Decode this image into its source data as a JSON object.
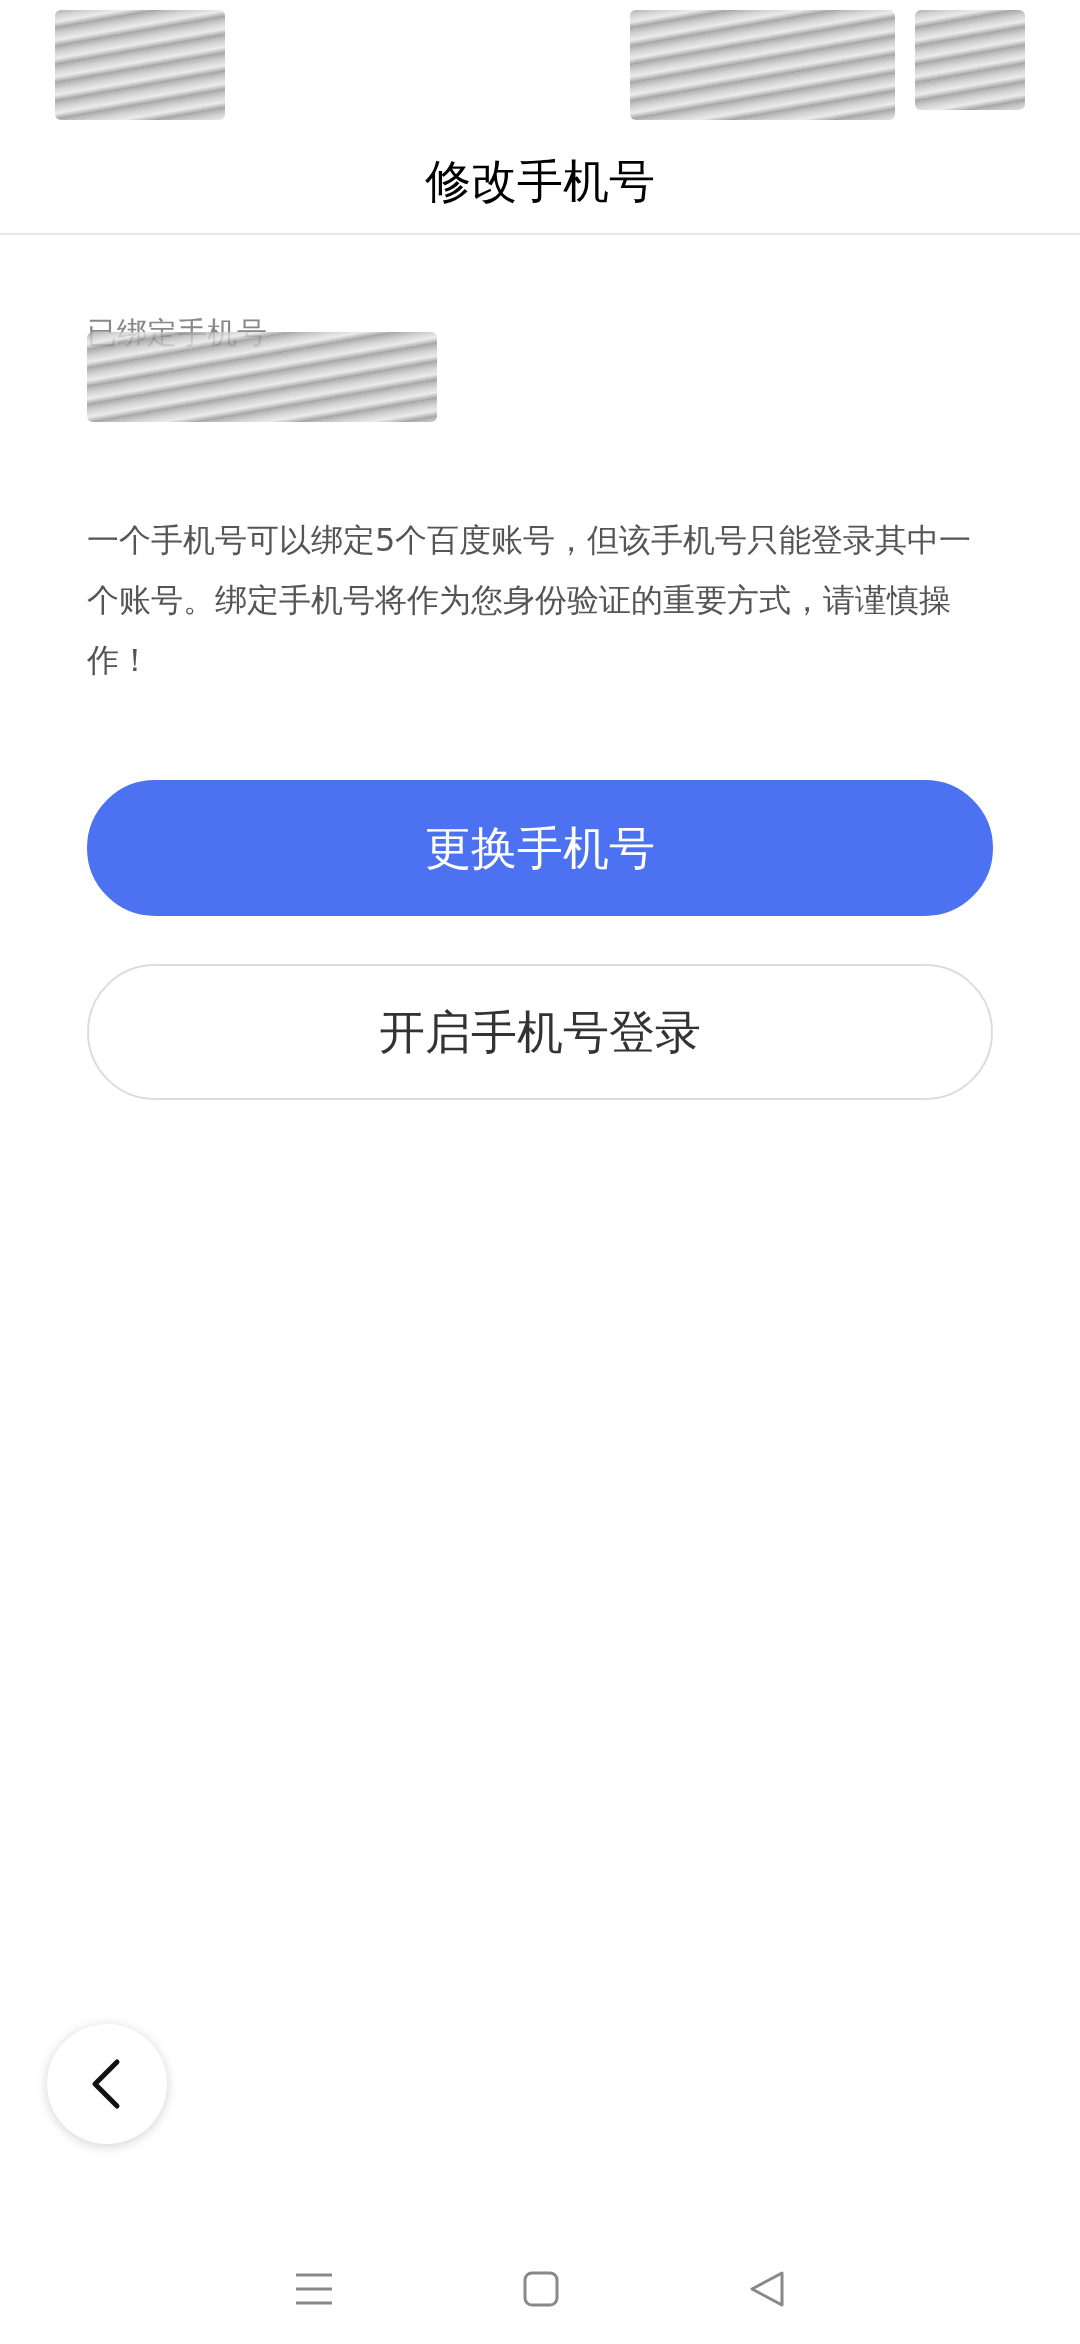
{
  "header": {
    "title": "修改手机号"
  },
  "bound_phone": {
    "label": "已绑定手机号"
  },
  "notice": "一个手机号可以绑定5个百度账号，但该手机号只能登录其中一个账号。绑定手机号将作为您身份验证的重要方式，请谨慎操作！",
  "buttons": [
    {
      "label": "更换手机号",
      "kind": "primary"
    },
    {
      "label": "开启手机号登录",
      "kind": "secondary"
    }
  ]
}
